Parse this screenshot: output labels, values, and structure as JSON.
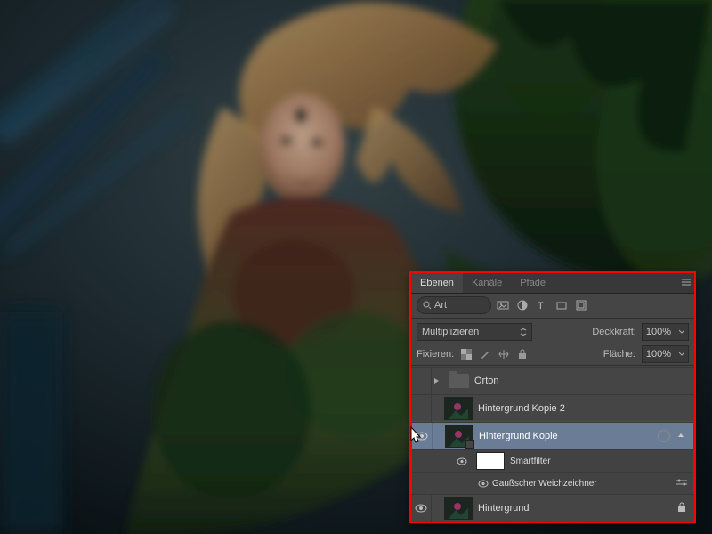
{
  "tabs": {
    "layers": "Ebenen",
    "channels": "Kanäle",
    "paths": "Pfade"
  },
  "search": {
    "placeholder": "Art"
  },
  "blend": {
    "mode": "Multiplizieren",
    "opacity_label": "Deckkraft:",
    "opacity": "100%",
    "fill_label": "Fläche:",
    "fill": "100%"
  },
  "lock": {
    "label": "Fixieren:"
  },
  "layers": {
    "group": "Orton",
    "copy2": "Hintergrund Kopie 2",
    "copy": "Hintergrund Kopie",
    "smart": "Smartfilter",
    "gauss": "Gaußscher Weichzeichner",
    "bg": "Hintergrund"
  }
}
